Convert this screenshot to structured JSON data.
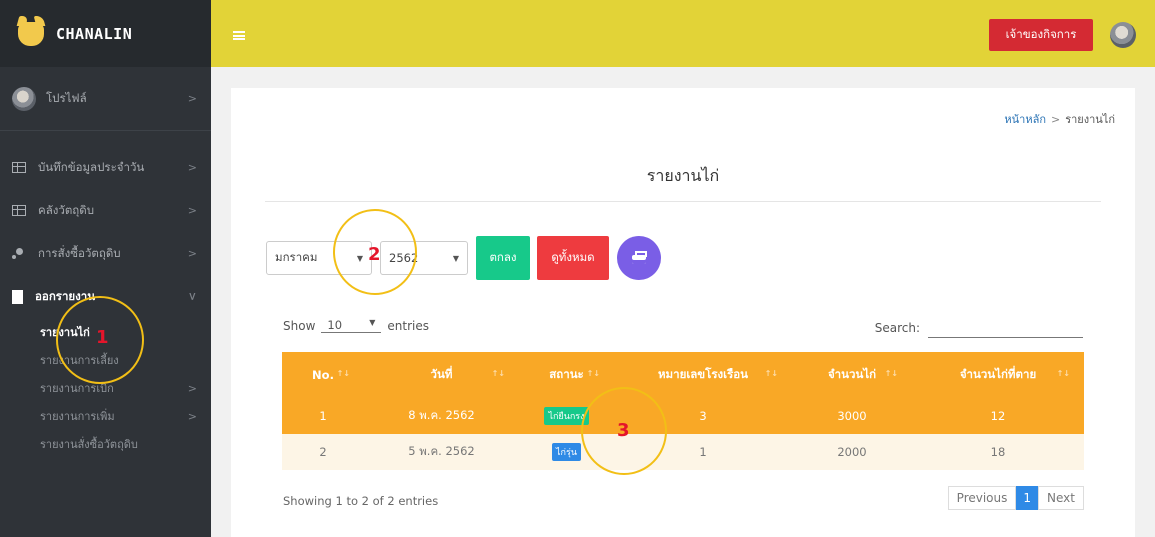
{
  "brand": {
    "name": "CHANALIN"
  },
  "sidebar": {
    "profile": "โปรไฟล์",
    "items": [
      {
        "label": "บันทึกข้อมูลประจำวัน"
      },
      {
        "label": "คลังวัตถุดิบ"
      },
      {
        "label": "การสั่งซื้อวัตถุดิบ"
      },
      {
        "label": "ออกรายงาน"
      }
    ],
    "sub_items": [
      {
        "label": "รายงานไก่"
      },
      {
        "label": "รายงานการเลี้ยง"
      },
      {
        "label": "รายงานการเบิก"
      },
      {
        "label": "รายงานการเพิ่ม"
      },
      {
        "label": "รายงานสั่งซื้อวัตถุดิบ"
      }
    ]
  },
  "header": {
    "owner_button": "เจ้าของกิจการ"
  },
  "breadcrumb": {
    "home": "หน้าหลัก",
    "sep": ">",
    "current": "รายงานไก่"
  },
  "page": {
    "title": "รายงานไก่"
  },
  "filters": {
    "month": "มกราคม",
    "year": "2562",
    "ok_button": "ตกลง",
    "all_button": "ดูทั้งหมด"
  },
  "table_controls": {
    "show": "Show",
    "length": "10",
    "entries": "entries",
    "search_label": "Search:"
  },
  "table": {
    "headers": [
      "No.",
      "วันที่",
      "สถานะ",
      "หมายเลขโรงเรือน",
      "จำนวนไก่",
      "จำนวนไก่ที่ตาย"
    ],
    "rows": [
      {
        "no": "1",
        "date": "8 พ.ค. 2562",
        "status": "ไก่ยืนกรง",
        "house": "3",
        "count": "3000",
        "dead": "12"
      },
      {
        "no": "2",
        "date": "5 พ.ค. 2562",
        "status": "ไก่รุ่น",
        "house": "1",
        "count": "2000",
        "dead": "18"
      }
    ]
  },
  "pagination": {
    "info": "Showing 1 to 2 of 2 entries",
    "previous": "Previous",
    "current": "1",
    "next": "Next"
  },
  "annotations": [
    "1",
    "2",
    "3"
  ],
  "colors": {
    "header": "#e2d337",
    "sidebar": "#2f3338",
    "table_header": "#f9a826",
    "owner_button": "#d42a33",
    "ok_button": "#17c98a",
    "all_button": "#ee3b3f",
    "print_button": "#7a5ee6",
    "annotation_circle": "#f2bf16",
    "annotation_number": "#e4152b"
  }
}
